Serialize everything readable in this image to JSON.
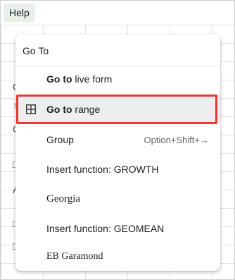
{
  "menubar": {
    "help_label": "Help"
  },
  "background_row_glyphs": [
    "C",
    "↑",
    "C",
    "□",
    "A",
    "□",
    "□"
  ],
  "dropdown": {
    "search_value": "Go To",
    "items": [
      {
        "bold": "Go to",
        "rest": " live form",
        "shortcut": ""
      },
      {
        "bold": "Go to",
        "rest": " range",
        "shortcut": "",
        "icon": "grid-icon",
        "highlighted": true
      },
      {
        "bold": "",
        "rest": "Group",
        "shortcut": "Option+Shift+→"
      },
      {
        "bold": "",
        "rest": "Insert function: GROWTH",
        "shortcut": ""
      },
      {
        "bold": "",
        "rest": "Georgia",
        "shortcut": ""
      },
      {
        "bold": "",
        "rest": "Insert function: GEOMEAN",
        "shortcut": ""
      },
      {
        "bold": "",
        "rest": "EB Garamond",
        "shortcut": ""
      }
    ]
  },
  "colors": {
    "highlight_border": "#e53935",
    "menu_tint": "#e8f0e9"
  }
}
